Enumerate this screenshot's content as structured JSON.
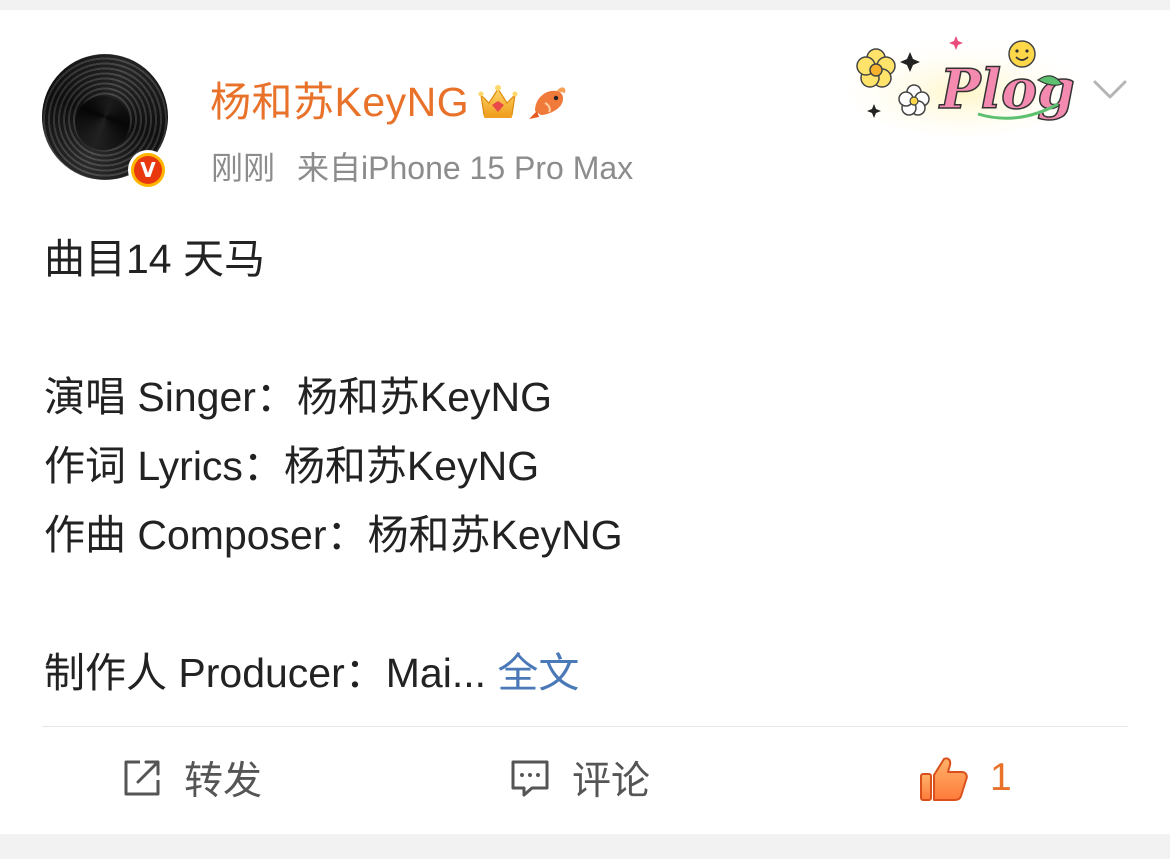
{
  "post": {
    "author": "杨和苏KeyNG",
    "time": "刚刚",
    "source": "来自iPhone 15 Pro Max",
    "content": {
      "line1": "曲目14 天马",
      "line2": "演唱 Singer：杨和苏KeyNG",
      "line3": "作词 Lyrics：杨和苏KeyNG",
      "line4": "作曲 Composer：杨和苏KeyNG",
      "line5": "制作人 Producer：Mai...",
      "full_text_link": "全文"
    },
    "sticker_text": "Plog"
  },
  "actions": {
    "repost_label": "转发",
    "comment_label": "评论",
    "like_count": "1"
  },
  "colors": {
    "username": "#e8722a",
    "link": "#4b79b7",
    "meta": "#8c8c8c",
    "like": "#e8722a"
  },
  "icons": [
    "avatar",
    "verified-v-badge-icon",
    "crown-icon",
    "fish-icon",
    "plog-sticker",
    "chevron-down-icon",
    "repost-icon",
    "comment-icon",
    "thumbs-up-icon"
  ]
}
